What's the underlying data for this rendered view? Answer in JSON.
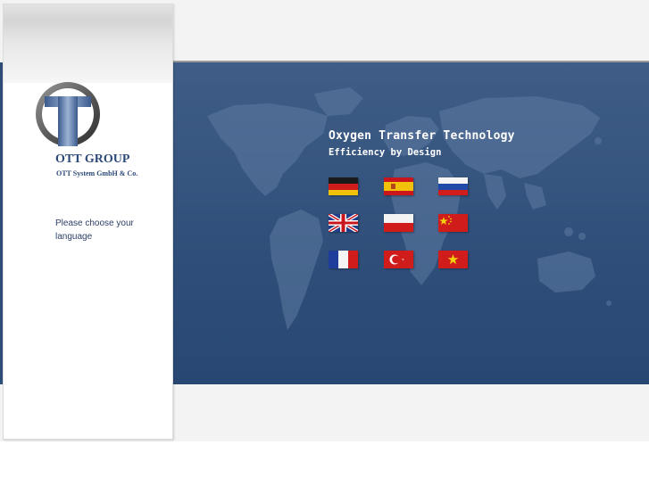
{
  "company": {
    "name": "OTT GROUP",
    "subtitle": "OTT System GmbH & Co."
  },
  "sidebar": {
    "prompt": "Please choose your language"
  },
  "hero": {
    "headline": "Oxygen Transfer Technology",
    "tagline": "Efficiency by Design"
  },
  "languages": [
    {
      "flag": "germany-flag"
    },
    {
      "flag": "spain-flag"
    },
    {
      "flag": "russia-flag"
    },
    {
      "flag": "uk-flag"
    },
    {
      "flag": "poland-flag"
    },
    {
      "flag": "china-flag"
    },
    {
      "flag": "france-flag"
    },
    {
      "flag": "turkey-flag"
    },
    {
      "flag": "vietnam-flag"
    }
  ],
  "colors": {
    "brand_blue": "#2c4a78",
    "hero_blue": "#2f4f7a",
    "text_white": "#ffffff"
  }
}
